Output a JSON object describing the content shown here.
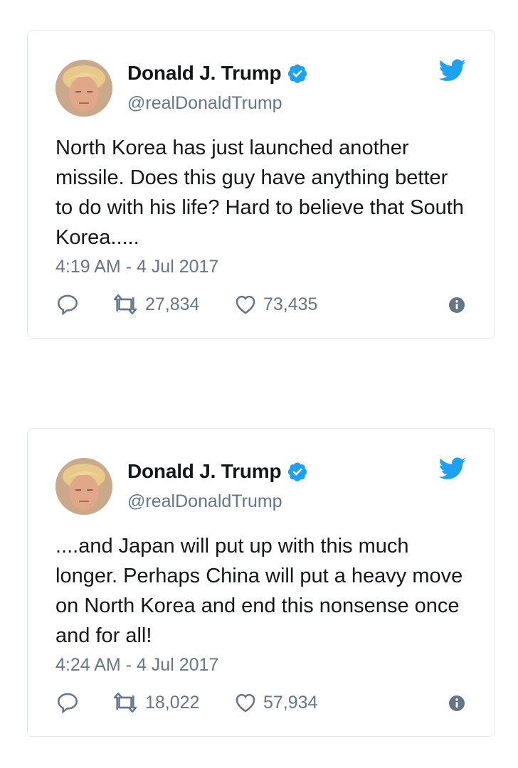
{
  "colors": {
    "verified": "#1da1f2",
    "twitter_blue": "#1da1f2",
    "muted": "#657786",
    "border": "#e1e8ed",
    "text": "#14171a"
  },
  "tweets": [
    {
      "name": "Donald J. Trump",
      "handle": "@realDonaldTrump",
      "text": "North Korea has just launched another missile. Does this guy have anything better to do with his life? Hard to believe that South Korea.....",
      "timestamp": "4:19 AM - 4 Jul 2017",
      "retweets": "27,834",
      "likes": "73,435",
      "icons": [
        "avatar",
        "verified-badge-icon",
        "twitter-bird-icon",
        "reply-icon",
        "retweet-icon",
        "like-icon",
        "info-icon"
      ]
    },
    {
      "name": "Donald J. Trump",
      "handle": "@realDonaldTrump",
      "text": "....and Japan will put up with this much longer. Perhaps China will put a heavy move on North Korea and end this nonsense once and for all!",
      "timestamp": "4:24 AM - 4 Jul 2017",
      "retweets": "18,022",
      "likes": "57,934",
      "icons": [
        "avatar",
        "verified-badge-icon",
        "twitter-bird-icon",
        "reply-icon",
        "retweet-icon",
        "like-icon",
        "info-icon"
      ]
    }
  ]
}
